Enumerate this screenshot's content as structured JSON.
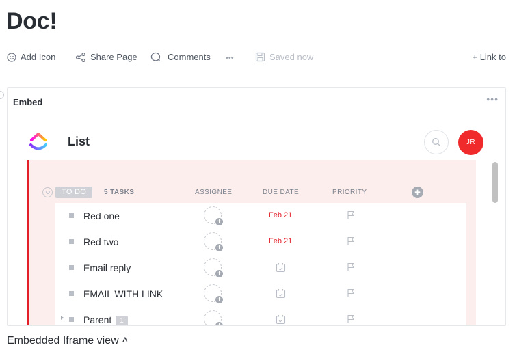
{
  "doc": {
    "title": "Doc!"
  },
  "toolbar": {
    "add_icon": "Add Icon",
    "share_page": "Share Page",
    "comments": "Comments",
    "more": "•••",
    "saved": "Saved now",
    "link_to": "+ Link to"
  },
  "embed": {
    "label": "Embed",
    "menu": "•••",
    "iframe": {
      "title": "List",
      "avatar_initials": "JR",
      "group": {
        "status": "TO DO",
        "task_count": "5 TASKS",
        "columns": [
          "ASSIGNEE",
          "DUE DATE",
          "PRIORITY"
        ],
        "add_column": "+"
      },
      "tasks": [
        {
          "name": "Red one",
          "due": "Feb 21"
        },
        {
          "name": "Red two",
          "due": "Feb 21"
        },
        {
          "name": "Email reply"
        },
        {
          "name": "EMAIL WITH LINK"
        },
        {
          "name": "Parent",
          "subtasks": "1"
        }
      ]
    }
  },
  "footer": {
    "caption": "Embedded Iframe view ˄"
  },
  "colors": {
    "accent_red": "#e3202a",
    "avatar_bg": "#f02a2a",
    "list_bg": "#fdeeee"
  }
}
